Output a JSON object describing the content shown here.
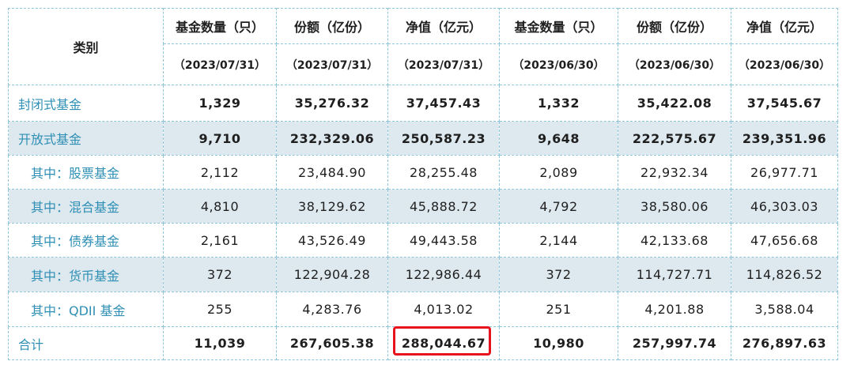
{
  "header": {
    "category": "类别",
    "columns": [
      {
        "title": "基金数量（只）",
        "date": "（2023/07/31）"
      },
      {
        "title": "份额（亿份）",
        "date": "（2023/07/31）"
      },
      {
        "title": "净值（亿元）",
        "date": "（2023/07/31）"
      },
      {
        "title": "基金数量（只）",
        "date": "（2023/06/30）"
      },
      {
        "title": "份额（亿份）",
        "date": "（2023/06/30）"
      },
      {
        "title": "净值（亿元）",
        "date": "（2023/06/30）"
      }
    ]
  },
  "rows": [
    {
      "label": "封闭式基金",
      "values": [
        "1,329",
        "35,276.32",
        "37,457.43",
        "1,332",
        "35,422.08",
        "37,545.67"
      ]
    },
    {
      "label": "开放式基金",
      "values": [
        "9,710",
        "232,329.06",
        "250,587.23",
        "9,648",
        "222,575.67",
        "239,351.96"
      ]
    },
    {
      "label": "其中：股票基金",
      "values": [
        "2,112",
        "23,484.90",
        "28,255.48",
        "2,089",
        "22,932.34",
        "26,977.71"
      ]
    },
    {
      "label": "其中：混合基金",
      "values": [
        "4,810",
        "38,129.62",
        "45,888.72",
        "4,792",
        "38,580.06",
        "46,303.03"
      ]
    },
    {
      "label": "其中：债券基金",
      "values": [
        "2,161",
        "43,526.49",
        "49,443.58",
        "2,144",
        "42,133.68",
        "47,656.68"
      ]
    },
    {
      "label": "其中：货币基金",
      "values": [
        "372",
        "122,904.28",
        "122,986.44",
        "372",
        "114,727.71",
        "114,826.52"
      ]
    },
    {
      "label": "其中：QDII 基金",
      "values": [
        "255",
        "4,283.76",
        "4,013.02",
        "251",
        "4,201.88",
        "3,588.04"
      ]
    },
    {
      "label": "合计",
      "values": [
        "11,039",
        "267,605.38",
        "288,044.67",
        "10,980",
        "257,997.74",
        "276,897.63"
      ]
    }
  ],
  "colors": {
    "header_text": "#2f8fb5",
    "row_shade": "#dde9ef",
    "grid_line": "#8fc6db",
    "highlight_border": "#e8121c"
  }
}
